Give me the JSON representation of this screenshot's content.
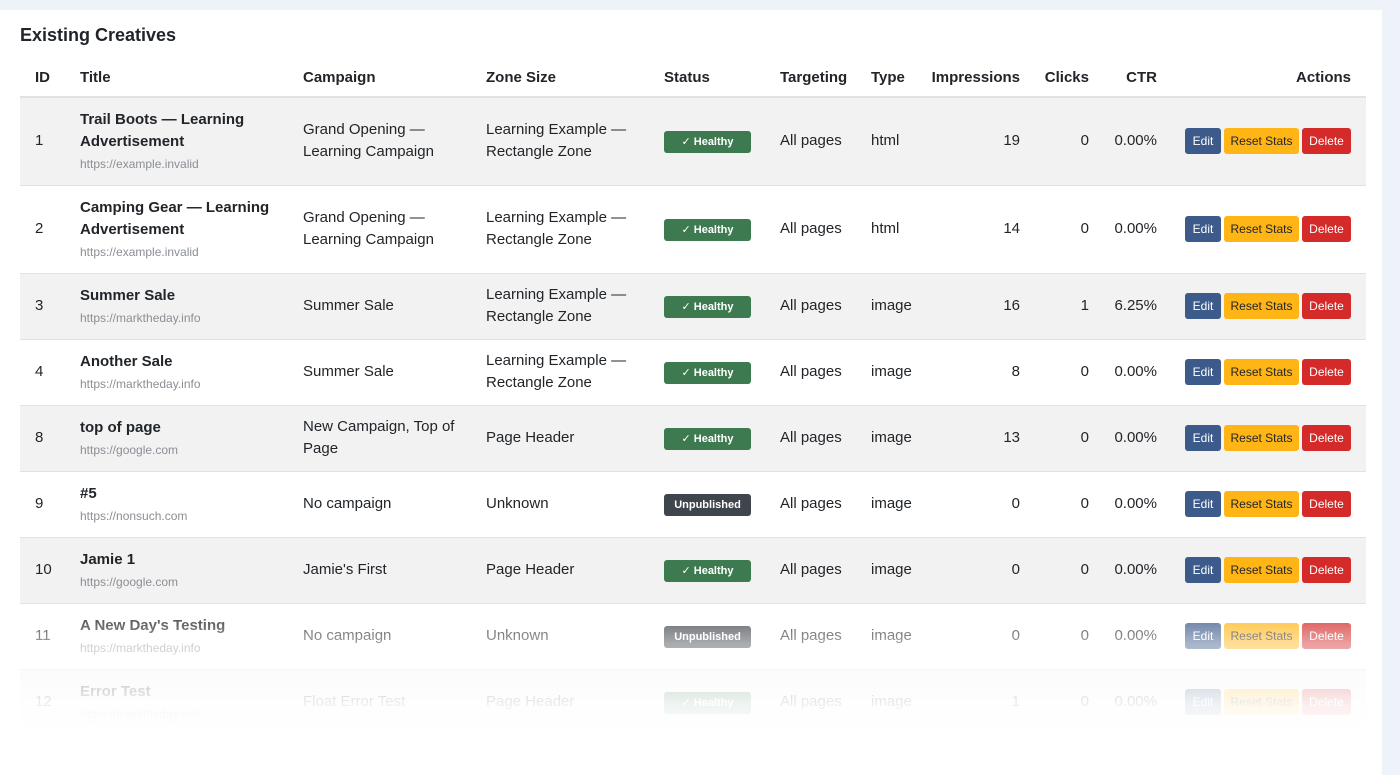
{
  "card_title": "Existing Creatives",
  "columns": {
    "id": "ID",
    "title": "Title",
    "campaign": "Campaign",
    "zone_size": "Zone Size",
    "status": "Status",
    "targeting": "Targeting",
    "type": "Type",
    "impressions": "Impressions",
    "clicks": "Clicks",
    "ctr": "CTR",
    "actions": "Actions"
  },
  "action_labels": {
    "edit": "Edit",
    "reset": "Reset Stats",
    "delete": "Delete"
  },
  "rows": [
    {
      "id": "1",
      "title": "Trail Boots — Learning Advertisement",
      "url": "https://example.invalid",
      "campaign": "Grand Opening — Learning Campaign",
      "zone": "Learning Example — Rectangle Zone",
      "status": "✓ Healthy",
      "status_kind": "healthy",
      "targeting": "All pages",
      "type": "html",
      "impressions": "19",
      "clicks": "0",
      "ctr": "0.00%"
    },
    {
      "id": "2",
      "title": "Camping Gear — Learning Advertisement",
      "url": "https://example.invalid",
      "campaign": "Grand Opening — Learning Campaign",
      "zone": "Learning Example — Rectangle Zone",
      "status": "✓ Healthy",
      "status_kind": "healthy",
      "targeting": "All pages",
      "type": "html",
      "impressions": "14",
      "clicks": "0",
      "ctr": "0.00%"
    },
    {
      "id": "3",
      "title": "Summer Sale",
      "url": "https://marktheday.info",
      "campaign": "Summer Sale",
      "zone": "Learning Example — Rectangle Zone",
      "status": "✓ Healthy",
      "status_kind": "healthy",
      "targeting": "All pages",
      "type": "image",
      "impressions": "16",
      "clicks": "1",
      "ctr": "6.25%"
    },
    {
      "id": "4",
      "title": "Another Sale",
      "url": "https://marktheday.info",
      "campaign": "Summer Sale",
      "zone": "Learning Example — Rectangle Zone",
      "status": "✓ Healthy",
      "status_kind": "healthy",
      "targeting": "All pages",
      "type": "image",
      "impressions": "8",
      "clicks": "0",
      "ctr": "0.00%"
    },
    {
      "id": "8",
      "title": "top of page",
      "url": "https://google.com",
      "campaign": "New Campaign, Top of Page",
      "zone": "Page Header",
      "status": "✓ Healthy",
      "status_kind": "healthy",
      "targeting": "All pages",
      "type": "image",
      "impressions": "13",
      "clicks": "0",
      "ctr": "0.00%"
    },
    {
      "id": "9",
      "title": "#5",
      "url": "https://nonsuch.com",
      "campaign": "No campaign",
      "zone": "Unknown",
      "status": "Unpublished",
      "status_kind": "unpublished",
      "targeting": "All pages",
      "type": "image",
      "impressions": "0",
      "clicks": "0",
      "ctr": "0.00%"
    },
    {
      "id": "10",
      "title": "Jamie 1",
      "url": "https://google.com",
      "campaign": "Jamie's First",
      "zone": "Page Header",
      "status": "✓ Healthy",
      "status_kind": "healthy",
      "targeting": "All pages",
      "type": "image",
      "impressions": "0",
      "clicks": "0",
      "ctr": "0.00%"
    },
    {
      "id": "11",
      "title": "A New Day's Testing",
      "url": "https://marktheday.info",
      "campaign": "No campaign",
      "zone": "Unknown",
      "status": "Unpublished",
      "status_kind": "unpublished",
      "targeting": "All pages",
      "type": "image",
      "impressions": "0",
      "clicks": "0",
      "ctr": "0.00%"
    },
    {
      "id": "12",
      "title": "Error Test",
      "url": "https://marktheday.info",
      "campaign": "Float Error Test",
      "zone": "Page Header",
      "status": "✓ Healthy",
      "status_kind": "healthy",
      "targeting": "All pages",
      "type": "image",
      "impressions": "1",
      "clicks": "0",
      "ctr": "0.00%"
    }
  ],
  "colors": {
    "healthy": "#3d7a4f",
    "unpublished": "#3f454c",
    "edit": "#3c5a8a",
    "reset": "#ffb516",
    "delete": "#d42a2a"
  }
}
